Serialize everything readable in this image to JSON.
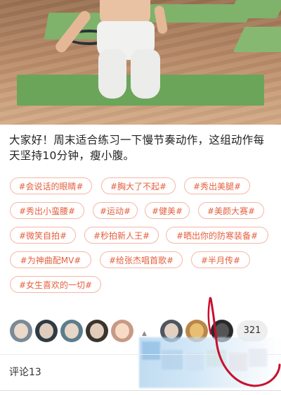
{
  "post": {
    "caption": "大家好！周末适合练习一下慢节奏动作，这组动作每天坚持10分钟，瘦小腹。"
  },
  "tags": [
    [
      "#会说话的眼睛#",
      "#胸大了不起#",
      "#秀出美腿#"
    ],
    [
      "#秀出小蛮腰#",
      "#运动#",
      "#健美#",
      "#美颜大赛#"
    ],
    [
      "#微笑自拍#",
      "#秒拍新人王#",
      "#晒出你的防寒装备#"
    ],
    [
      "#为神曲配MV#",
      "#给张杰唱首歌#",
      "#半月传#"
    ],
    [
      "#女生喜欢的一切#"
    ]
  ],
  "likes": {
    "count": "321",
    "avatar_colors": [
      "#7a8a96",
      "#2f3b44",
      "#5c7d8c",
      "#3a342e",
      "#c79a86",
      "#4d5560",
      "#b9864a",
      "#2a2a2a"
    ]
  },
  "comments": {
    "label": "评论13"
  },
  "colors": {
    "tag_text": "#e4603f",
    "tag_border": "#f5b7a6",
    "annotation": "#c8102e"
  }
}
